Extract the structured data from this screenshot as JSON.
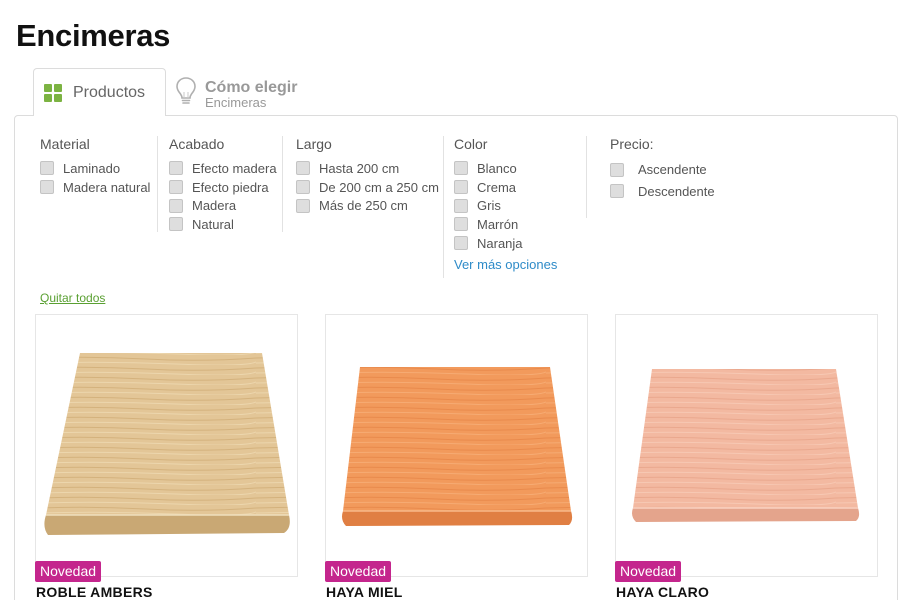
{
  "page": {
    "title": "Encimeras"
  },
  "tabs": {
    "products": {
      "label": "Productos",
      "icon": "grid-icon"
    },
    "how_to": {
      "title": "Cómo elegir",
      "subtitle": "Encimeras",
      "icon": "lightbulb-icon"
    }
  },
  "filters": {
    "material": {
      "title": "Material",
      "options": [
        "Laminado",
        "Madera natural"
      ]
    },
    "acabado": {
      "title": "Acabado",
      "options": [
        "Efecto madera",
        "Efecto piedra",
        "Madera",
        "Natural"
      ]
    },
    "largo": {
      "title": "Largo",
      "options": [
        "Hasta 200 cm",
        "De 200 cm a 250 cm",
        "Más de 250 cm"
      ]
    },
    "color": {
      "title": "Color",
      "options": [
        "Blanco",
        "Crema",
        "Gris",
        "Marrón",
        "Naranja"
      ],
      "more_label": "Ver más opciones"
    },
    "precio": {
      "title": "Precio:",
      "options": [
        "Ascendente",
        "Descendente"
      ]
    }
  },
  "clear_all": "Quitar todos",
  "products": [
    {
      "name": "ROBLE AMBERS",
      "badge": "Novedad",
      "color": "#e3c697"
    },
    {
      "name": "HAYA MIEL",
      "badge": "Novedad",
      "color": "#f29a5c"
    },
    {
      "name": "HAYA CLARO",
      "badge": "Novedad",
      "color": "#f3b9a1"
    }
  ],
  "colors": {
    "accent_green": "#7cb342",
    "badge_magenta": "#c4268d",
    "link_blue": "#2e8bc8"
  }
}
